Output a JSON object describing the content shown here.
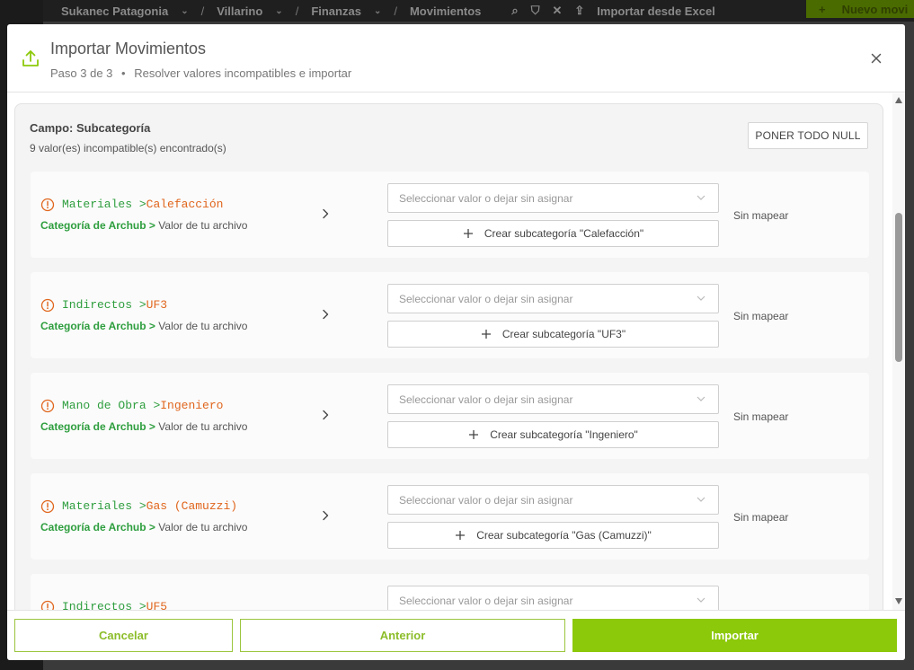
{
  "background": {
    "breadcrumb": [
      "Sukanec Patagonia",
      "Villarino",
      "Finanzas",
      "Movimientos"
    ],
    "import_label": "Importar desde Excel",
    "new_label": "Nuevo movi"
  },
  "modal": {
    "title": "Importar Movimientos",
    "step": "Paso 3 de 3",
    "step_desc": "Resolver valores incompatibles e importar",
    "bullet": "•"
  },
  "field": {
    "title": "Campo: Subcategoría",
    "count": "9 valor(es) incompatible(s) encontrado(s)",
    "null_button": "PONER TODO NULL"
  },
  "legend": {
    "category_label": "Categoría de Archub",
    "separator": ">",
    "file_value_label": "Valor de tu archivo"
  },
  "select_placeholder": "Seleccionar valor o dejar sin asignar",
  "rows": [
    {
      "category": "Materiales",
      "value": "Calefacción",
      "create_label": "Crear subcategoría \"Calefacción\"",
      "status": "Sin mapear"
    },
    {
      "category": "Indirectos",
      "value": "UF3",
      "create_label": "Crear subcategoría \"UF3\"",
      "status": "Sin mapear"
    },
    {
      "category": "Mano de Obra",
      "value": "Ingeniero",
      "create_label": "Crear subcategoría \"Ingeniero\"",
      "status": "Sin mapear"
    },
    {
      "category": "Materiales",
      "value": "Gas (Camuzzi)",
      "create_label": "Crear subcategoría \"Gas (Camuzzi)\"",
      "status": "Sin mapear"
    },
    {
      "category": "Indirectos",
      "value": "UF5",
      "create_label": "",
      "status": ""
    }
  ],
  "footer": {
    "cancel": "Cancelar",
    "previous": "Anterior",
    "import": "Importar"
  },
  "colors": {
    "accent": "#8cc90a",
    "category_green": "#2e9e3e",
    "value_orange": "#e0661d"
  }
}
